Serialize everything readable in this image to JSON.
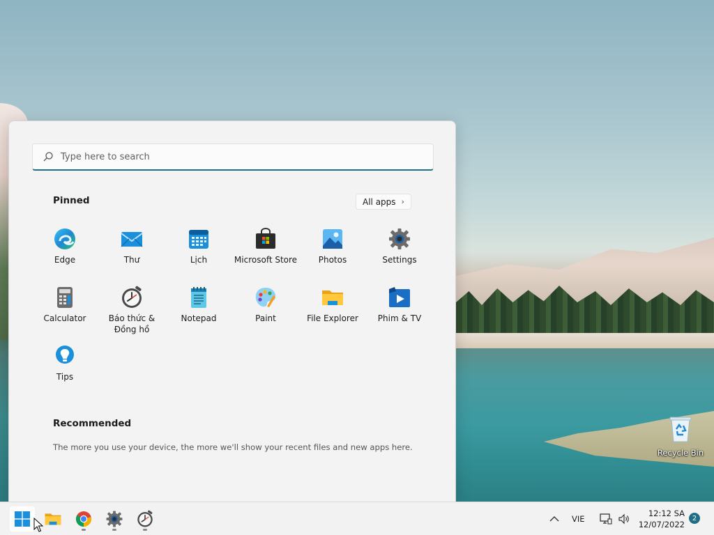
{
  "desktop": {
    "recycle_bin_label": "Recycle Bin"
  },
  "start_menu": {
    "search": {
      "placeholder": "Type here to search",
      "value": ""
    },
    "pinned_title": "Pinned",
    "all_apps_label": "All apps",
    "pinned_apps": [
      {
        "label": "Edge",
        "icon": "edge-icon"
      },
      {
        "label": "Thư",
        "icon": "mail-icon"
      },
      {
        "label": "Lịch",
        "icon": "calendar-icon"
      },
      {
        "label": "Microsoft Store",
        "icon": "store-icon"
      },
      {
        "label": "Photos",
        "icon": "photos-icon"
      },
      {
        "label": "Settings",
        "icon": "settings-icon"
      },
      {
        "label": "Calculator",
        "icon": "calculator-icon"
      },
      {
        "label": "Báo thức &",
        "label2": "Đồng hồ",
        "icon": "alarm-clock-icon"
      },
      {
        "label": "Notepad",
        "icon": "notepad-icon"
      },
      {
        "label": "Paint",
        "icon": "paint-icon"
      },
      {
        "label": "File Explorer",
        "icon": "folder-icon"
      },
      {
        "label": "Phim & TV",
        "icon": "movies-tv-icon"
      },
      {
        "label": "Tips",
        "icon": "tips-icon"
      }
    ],
    "recommended_title": "Recommended",
    "recommended_text": "The more you use your device, the more we'll show your recent files and new apps here."
  },
  "taskbar": {
    "items": [
      {
        "name": "start",
        "icon": "windows-start-icon",
        "active": true
      },
      {
        "name": "file-explorer",
        "icon": "folder-icon"
      },
      {
        "name": "chrome",
        "icon": "chrome-icon",
        "running": true
      },
      {
        "name": "settings",
        "icon": "settings-icon",
        "running": true
      },
      {
        "name": "alarms-clock",
        "icon": "alarm-clock-icon",
        "running": true
      }
    ],
    "tray": {
      "chevron": "chevron-up-icon",
      "language": "VIE",
      "time": "12:12 SA",
      "date": "12/07/2022",
      "notification_count": "2"
    }
  },
  "colors": {
    "accent": "#1f6f86",
    "menu_bg": "#f3f3f3",
    "taskbar_bg": "#f2f2f2"
  }
}
